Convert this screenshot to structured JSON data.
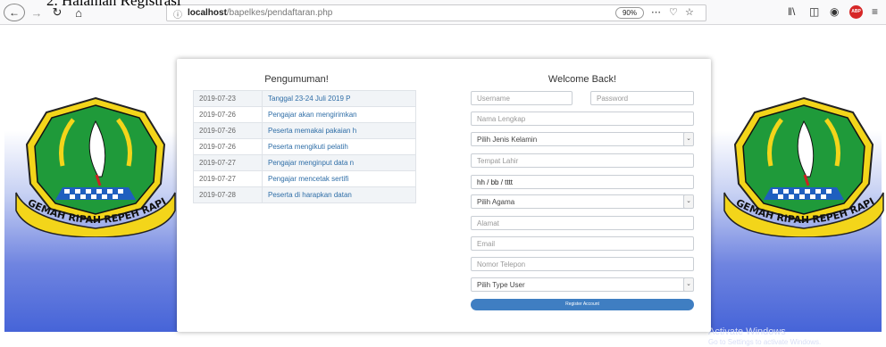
{
  "document": {
    "caption": "2. Halaman Registrasi"
  },
  "browser": {
    "url_host": "localhost",
    "url_path": "/bapelkes/pendaftaran.php",
    "zoom": "90%"
  },
  "announcements": {
    "title": "Pengumuman!",
    "rows": [
      {
        "date": "2019-07-23",
        "text": "Tanggal 23-24 Juli 2019 P"
      },
      {
        "date": "2019-07-26",
        "text": "Pengajar akan mengirimkan"
      },
      {
        "date": "2019-07-26",
        "text": "Peserta memakai pakaian h"
      },
      {
        "date": "2019-07-26",
        "text": "Peserta mengikuti pelatih"
      },
      {
        "date": "2019-07-27",
        "text": "Pengajar menginput data n"
      },
      {
        "date": "2019-07-27",
        "text": "Pengajar mencetak sertifi"
      },
      {
        "date": "2019-07-28",
        "text": "Peserta di harapkan datan"
      }
    ]
  },
  "form": {
    "title": "Welcome Back!",
    "username_placeholder": "Username",
    "password_placeholder": "Password",
    "fullname_placeholder": "Nama Lengkap",
    "gender_selected": "Pilih Jenis Kelamin",
    "birthplace_placeholder": "Tempat Lahir",
    "birthdate_value": "hh / bb / tttt",
    "religion_selected": "Pilih Agama",
    "address_placeholder": "Alamat",
    "email_placeholder": "Email",
    "phone_placeholder": "Nomor Telepon",
    "usertype_selected": "Pilih Type User",
    "register_label": "Register Account"
  },
  "emblem": {
    "motto": "GEMAH RIPAH REPEH RAPIH"
  },
  "watermark": {
    "title": "Activate Windows",
    "subtitle": "Go to Settings to activate Windows."
  },
  "icons": {
    "back": "arrow-left-icon",
    "forward": "arrow-right-icon",
    "reload": "reload-icon",
    "home": "home-icon",
    "info": "info-icon",
    "more": "more-icon",
    "pocket": "pocket-icon",
    "bookmark": "star-icon",
    "library": "library-icon",
    "sidebar": "sidebar-icon",
    "account": "account-icon",
    "adblock": "adblock-icon",
    "menu": "hamburger-menu-icon",
    "dropdown": "chevron-down-icon"
  },
  "colors": {
    "link": "#2f6ea7",
    "button": "#3f7ec2",
    "page_gradient_bottom": "#4664d8",
    "emblem_green": "#1f9a3a",
    "emblem_gold": "#f3d51a",
    "emblem_blue": "#1f5fbf"
  }
}
